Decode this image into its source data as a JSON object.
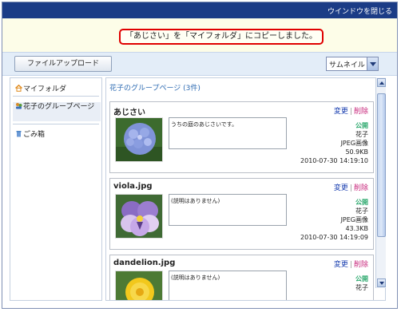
{
  "topbar": {
    "close_label": "ウインドウを閉じる",
    "color": "#1b3c86"
  },
  "notice": {
    "message": "「あじさい」を「マイフォルダ」にコピーしました。",
    "border_color": "#e00000"
  },
  "toolbar": {
    "upload_label": "ファイルアップロード",
    "view_select": {
      "selected": "サムネイル"
    }
  },
  "sidebar": {
    "items": [
      {
        "label": "マイフォルダ",
        "icon": "folder-home-icon"
      },
      {
        "label": "花子のグループページ",
        "icon": "group-icon"
      },
      {
        "label": "ごみ箱",
        "icon": "trash-icon"
      }
    ]
  },
  "content": {
    "title": "花子のグループページ (3件)",
    "cards": [
      {
        "title": "あじさい",
        "edit_label": "変更",
        "delete_label": "削除",
        "description": "うちの庭のあじさいです。",
        "status": "公開",
        "owner": "花子",
        "file_type": "JPEG画像",
        "size": "50.9KB",
        "date": "2010-07-30 14:19:10",
        "thumbnail": "hydrangea-image"
      },
      {
        "title": "viola.jpg",
        "edit_label": "変更",
        "delete_label": "削除",
        "description": "(説明はありません)",
        "status": "公開",
        "owner": "花子",
        "file_type": "JPEG画像",
        "size": "43.3KB",
        "date": "2010-07-30 14:19:09",
        "thumbnail": "viola-image"
      },
      {
        "title": "dandelion.jpg",
        "edit_label": "変更",
        "delete_label": "削除",
        "description": "(説明はありません)",
        "status": "公開",
        "owner": "花子",
        "thumbnail": "dandelion-image"
      }
    ]
  },
  "colors": {
    "accent": "#2f6cb3",
    "public_status": "#2aa86c",
    "edit_link": "#1a3fb0",
    "delete_link": "#c7247a"
  }
}
